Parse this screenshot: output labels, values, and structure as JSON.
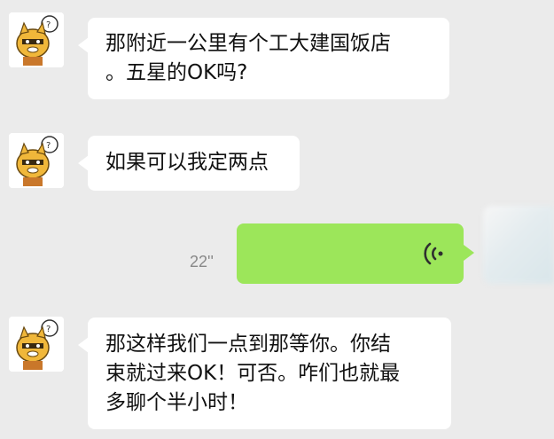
{
  "conversation": {
    "messages": [
      {
        "sender": "contact",
        "type": "text",
        "text": "那附近一公里有个工大建国饭店\n。五星的OK吗?"
      },
      {
        "sender": "contact",
        "type": "text",
        "text": "如果可以我定两点"
      },
      {
        "sender": "self",
        "type": "voice",
        "duration": "22''",
        "icon": "voice-wave-icon"
      },
      {
        "sender": "contact",
        "type": "text",
        "text": "那这样我们一点到那等你。你结\n束就过来OK！可否。咋们也就最\n多聊个半小时！"
      }
    ]
  },
  "colors": {
    "background": "#ebebeb",
    "incoming_bubble": "#ffffff",
    "outgoing_bubble": "#9ce65a",
    "text": "#111111",
    "duration_text": "#888888"
  }
}
